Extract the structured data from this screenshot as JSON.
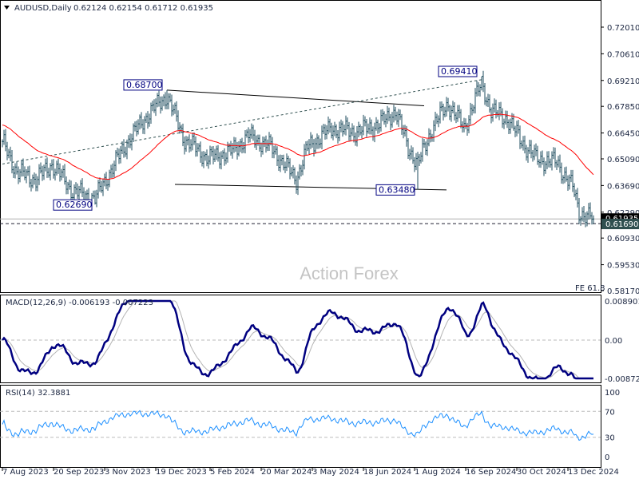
{
  "header": {
    "symbol_timeframe": "AUDUSD,Daily",
    "ohlc": "0.62124 0.62154 0.61712 0.61935"
  },
  "watermark": "Action Forex",
  "fe_label": "FE 61.8",
  "colors": {
    "bars": "#1f4e5f",
    "moving_average": "#ff0000",
    "macd": "#000080",
    "macd_signal": "#b4b4b4",
    "rsi": "#1e90ff",
    "annotation_box": "#000080"
  },
  "chart_data": [
    {
      "type": "ohlc",
      "title": "AUDUSD,Daily",
      "ylim": [
        0.5817,
        0.7201
      ],
      "y_ticks": [
        "0.72010",
        "0.70610",
        "0.69210",
        "0.67850",
        "0.66450",
        "0.65090",
        "0.63690",
        "0.62290",
        "0.60930",
        "0.59530",
        "0.58170"
      ],
      "current_price": "0.61935",
      "level_line": "0.61690",
      "x_labels": [
        "7 Aug 2023",
        "20 Sep 2023",
        "3 Nov 2023",
        "19 Dec 2023",
        "5 Feb 2024",
        "20 Mar 2024",
        "3 May 2024",
        "18 Jun 2024",
        "1 Aug 2024",
        "16 Sep 2024",
        "30 Oct 2024",
        "13 Dec 2024"
      ],
      "approx_closes": [
        [
          "2023-08-07",
          0.66
        ],
        [
          "2023-08-18",
          0.644
        ],
        [
          "2023-09-05",
          0.64
        ],
        [
          "2023-09-19",
          0.648
        ],
        [
          "2023-10-06",
          0.634
        ],
        [
          "2023-10-26",
          0.63
        ],
        [
          "2023-11-07",
          0.642
        ],
        [
          "2023-11-24",
          0.661
        ],
        [
          "2023-12-14",
          0.676
        ],
        [
          "2023-12-28",
          0.684
        ],
        [
          "2024-01-12",
          0.661
        ],
        [
          "2024-02-02",
          0.651
        ],
        [
          "2024-02-23",
          0.655
        ],
        [
          "2024-03-08",
          0.663
        ],
        [
          "2024-03-28",
          0.657
        ],
        [
          "2024-04-19",
          0.64
        ],
        [
          "2024-04-30",
          0.657
        ],
        [
          "2024-05-21",
          0.667
        ],
        [
          "2024-06-11",
          0.665
        ],
        [
          "2024-07-02",
          0.669
        ],
        [
          "2024-07-16",
          0.676
        ],
        [
          "2024-07-26",
          0.657
        ],
        [
          "2024-08-05",
          0.648
        ],
        [
          "2024-08-16",
          0.667
        ],
        [
          "2024-08-30",
          0.68
        ],
        [
          "2024-09-13",
          0.667
        ],
        [
          "2024-09-30",
          0.691
        ],
        [
          "2024-10-08",
          0.676
        ],
        [
          "2024-10-22",
          0.672
        ],
        [
          "2024-11-05",
          0.659
        ],
        [
          "2024-11-15",
          0.651
        ],
        [
          "2024-12-04",
          0.649
        ],
        [
          "2024-12-18",
          0.636
        ],
        [
          "2024-12-24",
          0.623
        ],
        [
          "2025-01-06",
          0.61935
        ]
      ],
      "annotations": [
        {
          "label": "0.68700",
          "date": "2023-12-28",
          "price": 0.687,
          "kind": "high"
        },
        {
          "label": "0.62690",
          "date": "2023-10-26",
          "price": 0.6269,
          "kind": "low"
        },
        {
          "label": "0.63480",
          "date": "2024-08-05",
          "price": 0.6348,
          "kind": "low"
        },
        {
          "label": "0.69410",
          "date": "2024-09-30",
          "price": 0.6941,
          "kind": "high"
        }
      ],
      "trendlines": [
        {
          "from": [
            "2023-12-28",
            0.687
          ],
          "to": [
            "2024-08-09",
            0.6788
          ],
          "style": "solid"
        },
        {
          "from": [
            "2024-01-04",
            0.6375
          ],
          "to": [
            "2024-08-29",
            0.6346
          ],
          "style": "solid"
        },
        {
          "from": [
            "2023-08-07",
            0.6482
          ],
          "to": [
            "2024-09-30",
            0.6925
          ],
          "style": "dashed"
        }
      ]
    },
    {
      "type": "line",
      "title": "MACD(12,26,9) -0.006193 -0.007223",
      "y_ticks": [
        "0.008901",
        "0.00",
        "-0.008729"
      ],
      "ylim": [
        -0.008729,
        0.008901
      ]
    },
    {
      "type": "line",
      "title": "RSI(14) 32.3881",
      "y_ticks": [
        "100",
        "70",
        "30",
        "0"
      ],
      "ylim": [
        0,
        100
      ],
      "levels": [
        70,
        30
      ]
    }
  ]
}
